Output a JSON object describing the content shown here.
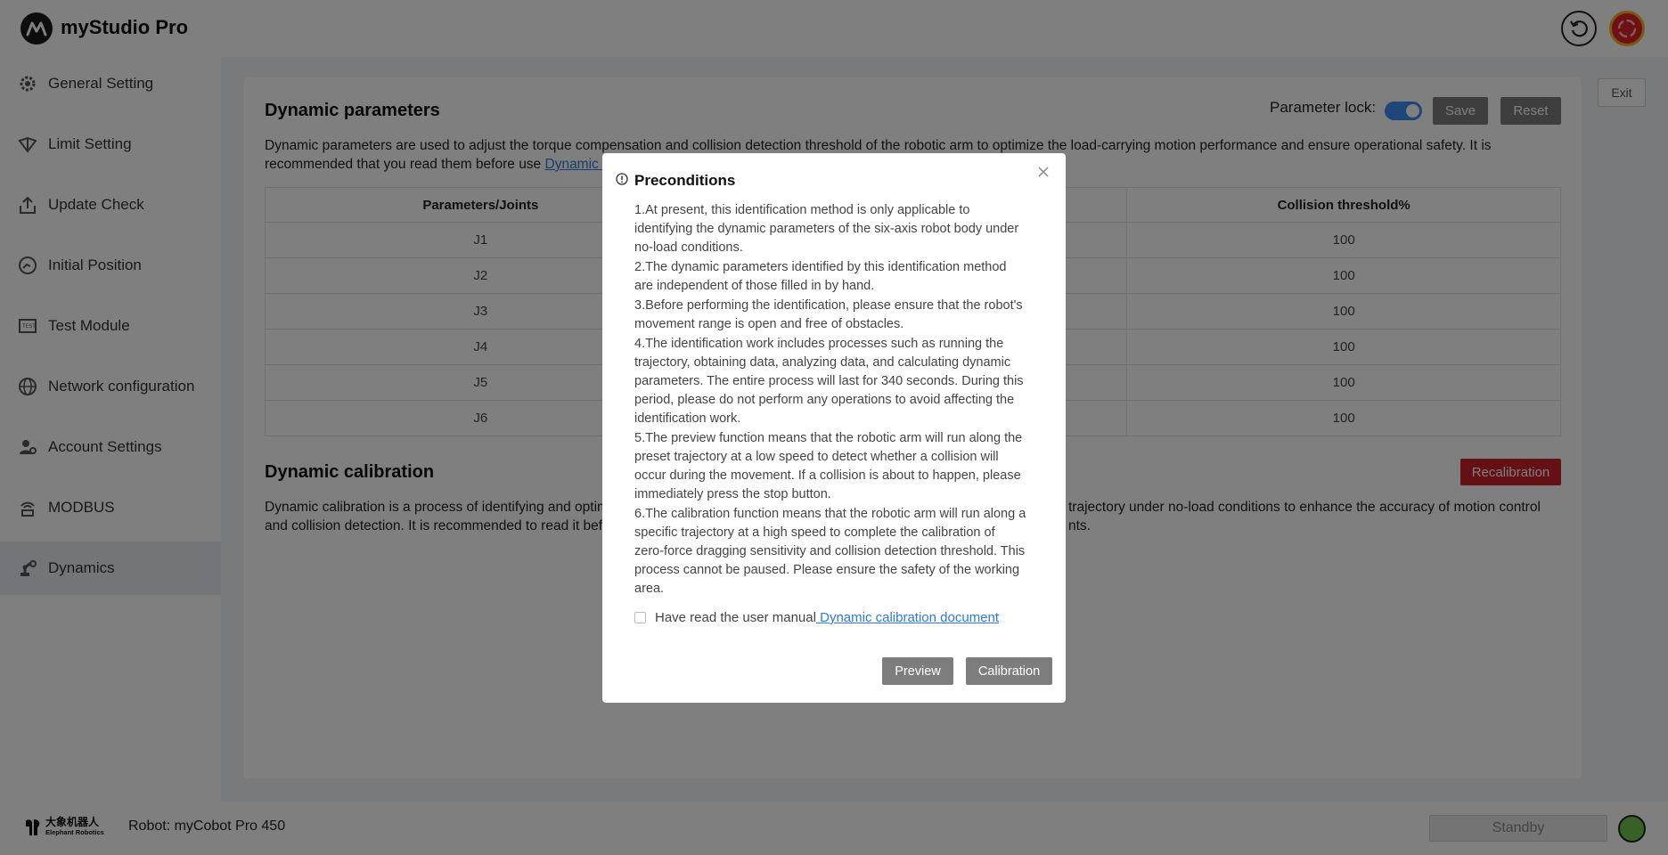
{
  "app": {
    "title": "myStudio Pro"
  },
  "header": {
    "undo_icon": "undo-icon",
    "estop_icon": "emergency-stop-icon"
  },
  "sidebar": {
    "items": [
      {
        "label": "General Setting",
        "icon": "gear-icon"
      },
      {
        "label": "Limit Setting",
        "icon": "limit-icon"
      },
      {
        "label": "Update Check",
        "icon": "upload-icon"
      },
      {
        "label": "Initial Position",
        "icon": "position-icon"
      },
      {
        "label": "Test Module",
        "icon": "test-icon"
      },
      {
        "label": "Network configuration",
        "icon": "globe-icon"
      },
      {
        "label": "Account Settings",
        "icon": "user-gear-icon"
      },
      {
        "label": "MODBUS",
        "icon": "modbus-icon"
      },
      {
        "label": "Dynamics",
        "icon": "robot-arm-icon",
        "active": true
      }
    ]
  },
  "main": {
    "exit_label": "Exit",
    "dynamic_parameters": {
      "title": "Dynamic parameters",
      "param_lock_label": "Parameter lock:",
      "param_lock_on": true,
      "save_label": "Save",
      "reset_label": "Reset",
      "desc_line1": "Dynamic parameters are used to adjust the torque compensation and collision detection threshold of the robotic arm to optimize the load-carrying motion performance and ensure operational safety. It is",
      "desc_line2_prefix": "recommended that you read them before use ",
      "desc_link": "Dynamic p",
      "table": {
        "headers": [
          "Parameters/Joints",
          "Collision threshold%"
        ],
        "rows": [
          {
            "joint": "J1",
            "threshold": "100"
          },
          {
            "joint": "J2",
            "threshold": "100"
          },
          {
            "joint": "J3",
            "threshold": "100"
          },
          {
            "joint": "J4",
            "threshold": "100"
          },
          {
            "joint": "J5",
            "threshold": "100"
          },
          {
            "joint": "J6",
            "threshold": "100"
          }
        ]
      }
    },
    "dynamic_calibration": {
      "title": "Dynamic calibration",
      "recalibration_label": "Recalibration",
      "desc_line1_left": "Dynamic calibration is a process of identifying and optim",
      "desc_line1_right": "trajectory under no-load conditions to enhance the accuracy of motion control",
      "desc_line2_left": "and collision detection. It is recommended to read it bef",
      "desc_line2_right": "nts."
    }
  },
  "modal": {
    "title": "Preconditions",
    "items": [
      "1.At present, this identification method is only applicable to identifying the dynamic parameters of the six-axis robot body under no-load conditions.",
      "2.The dynamic parameters identified by this identification method are independent of those filled in by hand.",
      "3.Before performing the identification, please ensure that the robot's movement range is open and free of obstacles.",
      "4.The identification work includes processes such as running the trajectory, obtaining data, analyzing data, and calculating dynamic parameters. The entire process will last for 340 seconds. During this period, please do not perform any operations to avoid affecting the identification work.",
      "5.The preview function means that the robotic arm will run along the preset trajectory at a low speed to detect whether a collision will occur during the movement. If a collision is about to happen, please immediately press the stop button.",
      "6.The calibration function means that the robotic arm will run along a specific trajectory at a high speed to complete the calibration of zero-force dragging sensitivity and collision detection threshold. This process cannot be paused. Please ensure the safety of the working area."
    ],
    "agree_label": "Have read the user manual",
    "agree_link": " Dynamic calibration document",
    "agree_checked": false,
    "preview_label": "Preview",
    "calibration_label": "Calibration"
  },
  "footer": {
    "brand_cn": "大象机器人",
    "brand_en": "Elephant Robotics",
    "robot_label": "Robot: myCobot Pro 450",
    "status_label": "Standby",
    "status_color": "#6fc24c"
  }
}
